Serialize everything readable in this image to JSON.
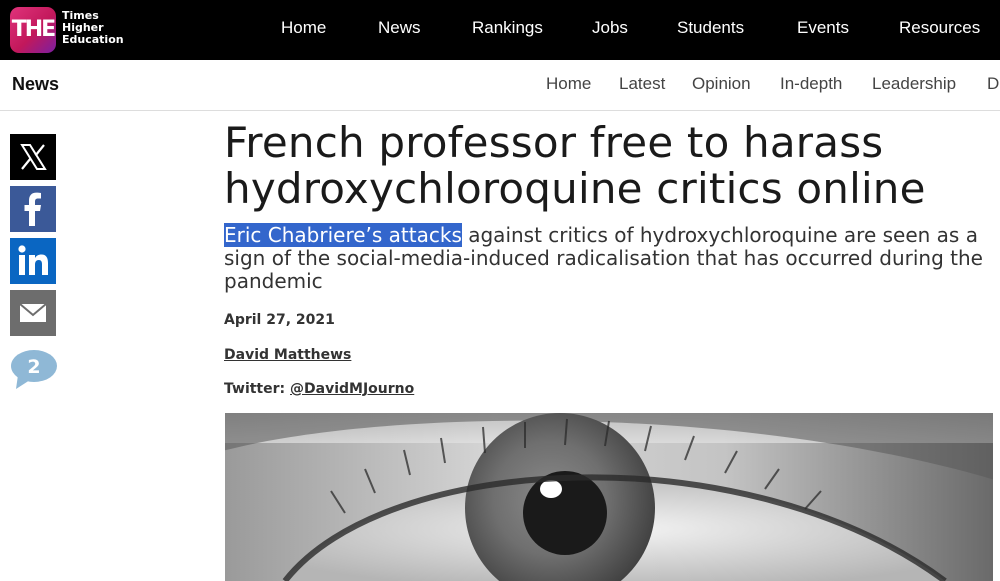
{
  "header": {
    "logo_text": "THE",
    "brand_lines": [
      "Times",
      "Higher",
      "Education"
    ],
    "nav": [
      "Home",
      "News",
      "Rankings",
      "Jobs",
      "Students",
      "Events",
      "Resources"
    ]
  },
  "subheader": {
    "section": "News",
    "nav": [
      "Home",
      "Latest",
      "Opinion",
      "In-depth",
      "Leadership",
      "D"
    ]
  },
  "share": {
    "icons": [
      "x-icon",
      "facebook-icon",
      "linkedin-icon",
      "email-icon"
    ],
    "comment_count": "2"
  },
  "article": {
    "headline_line1": "French professor free to harass",
    "headline_line2": "hydroxychloroquine critics online",
    "standfirst_highlighted": "Eric Chabriere’s attacks",
    "standfirst_rest": " against critics of hydroxychloroquine are seen as a sign of the social-media-induced radicalisation that has occurred during the pandemic",
    "date": "April 27, 2021",
    "author": "David Matthews",
    "twitter_label": "Twitter: ",
    "twitter_handle": "@DavidMJourno"
  },
  "colors": {
    "top_bar": "#000000",
    "logo_gradient": [
      "#e0337b",
      "#7b1fa2"
    ],
    "selection_highlight": "#3366cc",
    "facebook": "#3b5998",
    "linkedin": "#0a66c2",
    "email": "#6d6d6d",
    "comment_bubble": "#8fb8d6"
  }
}
